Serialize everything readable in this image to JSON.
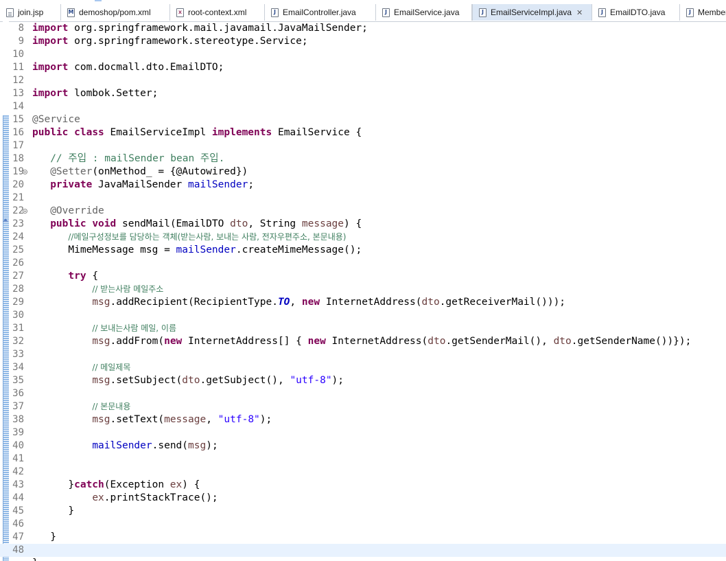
{
  "tabs": [
    {
      "label": "join.jsp",
      "icon": "jsp-file-icon",
      "active": false
    },
    {
      "label": "demoshop/pom.xml",
      "icon": "maven-pom-icon",
      "active": false
    },
    {
      "label": "root-context.xml",
      "icon": "xml-file-icon",
      "active": false
    },
    {
      "label": "EmailController.java",
      "icon": "java-file-icon",
      "active": false
    },
    {
      "label": "EmailService.java",
      "icon": "java-file-icon",
      "active": false
    },
    {
      "label": "EmailServiceImpl.java",
      "icon": "java-file-icon",
      "active": true,
      "close": "✕"
    },
    {
      "label": "EmailDTO.java",
      "icon": "java-file-icon",
      "active": false
    },
    {
      "label": "Member",
      "icon": "java-file-icon",
      "active": false
    }
  ],
  "editor": {
    "current_line": 48,
    "lines": [
      {
        "n": "8",
        "tokens": [
          [
            "kw",
            "import"
          ],
          [
            "t",
            " org.springframework.mail.javamail.JavaMailSender;"
          ]
        ]
      },
      {
        "n": "9",
        "tokens": [
          [
            "kw",
            "import"
          ],
          [
            "t",
            " org.springframework.stereotype.Service;"
          ]
        ]
      },
      {
        "n": "10",
        "tokens": []
      },
      {
        "n": "11",
        "tokens": [
          [
            "kw",
            "import"
          ],
          [
            "t",
            " com.docmall.dto.EmailDTO;"
          ]
        ]
      },
      {
        "n": "12",
        "tokens": []
      },
      {
        "n": "13",
        "tokens": [
          [
            "kw",
            "import"
          ],
          [
            "t",
            " lombok.Setter;"
          ]
        ]
      },
      {
        "n": "14",
        "tokens": []
      },
      {
        "n": "15",
        "tokens": [
          [
            "ann",
            "@Service"
          ]
        ]
      },
      {
        "n": "16",
        "tokens": [
          [
            "kw",
            "public"
          ],
          [
            "t",
            " "
          ],
          [
            "kw",
            "class"
          ],
          [
            "t",
            " EmailServiceImpl "
          ],
          [
            "kw",
            "implements"
          ],
          [
            "t",
            " EmailService {"
          ]
        ]
      },
      {
        "n": "17",
        "tokens": []
      },
      {
        "n": "18",
        "tokens": [
          [
            "t",
            "   "
          ],
          [
            "cm",
            "// 주입 : mailSender bean 주입."
          ]
        ]
      },
      {
        "n": "19",
        "fold": true,
        "tokens": [
          [
            "t",
            "   "
          ],
          [
            "ann",
            "@Setter"
          ],
          [
            "t",
            "(onMethod_ = {@Autowired})"
          ]
        ]
      },
      {
        "n": "20",
        "tokens": [
          [
            "t",
            "   "
          ],
          [
            "kw",
            "private"
          ],
          [
            "t",
            " JavaMailSender "
          ],
          [
            "fld",
            "mailSender"
          ],
          [
            "t",
            ";"
          ]
        ]
      },
      {
        "n": "21",
        "tokens": []
      },
      {
        "n": "22",
        "fold": true,
        "tokens": [
          [
            "t",
            "   "
          ],
          [
            "ann",
            "@Override"
          ]
        ]
      },
      {
        "n": "23",
        "override": true,
        "tokens": [
          [
            "t",
            "   "
          ],
          [
            "kw",
            "public"
          ],
          [
            "t",
            " "
          ],
          [
            "kw",
            "void"
          ],
          [
            "t",
            " sendMail(EmailDTO "
          ],
          [
            "par",
            "dto"
          ],
          [
            "t",
            ", String "
          ],
          [
            "par",
            "message"
          ],
          [
            "t",
            ") {"
          ]
        ]
      },
      {
        "n": "24",
        "tokens": [
          [
            "t",
            "      "
          ],
          [
            "cmk",
            "//메일구성정보를 담당하는 객체(받는사람, 보내는 사람, 전자우편주소, 본문내용)"
          ]
        ]
      },
      {
        "n": "25",
        "tokens": [
          [
            "t",
            "      MimeMessage "
          ],
          [
            "t",
            "msg"
          ],
          [
            "t",
            " = "
          ],
          [
            "fld",
            "mailSender"
          ],
          [
            "t",
            ".createMimeMessage();"
          ]
        ]
      },
      {
        "n": "26",
        "tokens": []
      },
      {
        "n": "27",
        "tokens": [
          [
            "t",
            "      "
          ],
          [
            "kw",
            "try"
          ],
          [
            "t",
            " {"
          ]
        ]
      },
      {
        "n": "28",
        "tokens": [
          [
            "t",
            "          "
          ],
          [
            "cmk",
            "// 받는사람 메일주소"
          ]
        ]
      },
      {
        "n": "29",
        "tokens": [
          [
            "t",
            "          "
          ],
          [
            "par",
            "msg"
          ],
          [
            "t",
            ".addRecipient(RecipientType."
          ],
          [
            "sfl",
            "TO"
          ],
          [
            "t",
            ", "
          ],
          [
            "kw",
            "new"
          ],
          [
            "t",
            " InternetAddress("
          ],
          [
            "par",
            "dto"
          ],
          [
            "t",
            ".getReceiverMail()));"
          ]
        ]
      },
      {
        "n": "30",
        "tokens": []
      },
      {
        "n": "31",
        "tokens": [
          [
            "t",
            "          "
          ],
          [
            "cmk",
            "// 보내는사람 메일, 이름"
          ]
        ]
      },
      {
        "n": "32",
        "tokens": [
          [
            "t",
            "          "
          ],
          [
            "par",
            "msg"
          ],
          [
            "t",
            ".addFrom("
          ],
          [
            "kw",
            "new"
          ],
          [
            "t",
            " InternetAddress[] { "
          ],
          [
            "kw",
            "new"
          ],
          [
            "t",
            " InternetAddress("
          ],
          [
            "par",
            "dto"
          ],
          [
            "t",
            ".getSenderMail(), "
          ],
          [
            "par",
            "dto"
          ],
          [
            "t",
            ".getSenderName())});"
          ]
        ]
      },
      {
        "n": "33",
        "tokens": []
      },
      {
        "n": "34",
        "tokens": [
          [
            "t",
            "          "
          ],
          [
            "cmk",
            "// 메일제목"
          ]
        ]
      },
      {
        "n": "35",
        "tokens": [
          [
            "t",
            "          "
          ],
          [
            "par",
            "msg"
          ],
          [
            "t",
            ".setSubject("
          ],
          [
            "par",
            "dto"
          ],
          [
            "t",
            ".getSubject(), "
          ],
          [
            "str",
            "\"utf-8\""
          ],
          [
            "t",
            ");"
          ]
        ]
      },
      {
        "n": "36",
        "tokens": []
      },
      {
        "n": "37",
        "tokens": [
          [
            "t",
            "          "
          ],
          [
            "cmk",
            "// 본문내용"
          ]
        ]
      },
      {
        "n": "38",
        "tokens": [
          [
            "t",
            "          "
          ],
          [
            "par",
            "msg"
          ],
          [
            "t",
            ".setText("
          ],
          [
            "par",
            "message"
          ],
          [
            "t",
            ", "
          ],
          [
            "str",
            "\"utf-8\""
          ],
          [
            "t",
            ");"
          ]
        ]
      },
      {
        "n": "39",
        "tokens": []
      },
      {
        "n": "40",
        "tokens": [
          [
            "t",
            "          "
          ],
          [
            "fld",
            "mailSender"
          ],
          [
            "t",
            ".send("
          ],
          [
            "par",
            "msg"
          ],
          [
            "t",
            ");"
          ]
        ]
      },
      {
        "n": "41",
        "tokens": []
      },
      {
        "n": "42",
        "tokens": []
      },
      {
        "n": "43",
        "tokens": [
          [
            "t",
            "      }"
          ],
          [
            "kw",
            "catch"
          ],
          [
            "t",
            "(Exception "
          ],
          [
            "par",
            "ex"
          ],
          [
            "t",
            ") {"
          ]
        ]
      },
      {
        "n": "44",
        "tokens": [
          [
            "t",
            "          "
          ],
          [
            "par",
            "ex"
          ],
          [
            "t",
            ".printStackTrace();"
          ]
        ]
      },
      {
        "n": "45",
        "tokens": [
          [
            "t",
            "      }"
          ]
        ]
      },
      {
        "n": "46",
        "tokens": []
      },
      {
        "n": "47",
        "tokens": [
          [
            "t",
            "   }"
          ]
        ]
      },
      {
        "n": "48",
        "tokens": []
      },
      {
        "n": "",
        "tokens": [
          [
            "t",
            "}"
          ]
        ]
      }
    ]
  },
  "colors": {
    "keyword": "#7f0055",
    "annotation": "#646464",
    "comment": "#3f7f5f",
    "field": "#0000c0",
    "parameter": "#6a3e3e",
    "string": "#2a00ff",
    "current_line": "#e8f2fe",
    "active_tab": "#dce7f5"
  }
}
